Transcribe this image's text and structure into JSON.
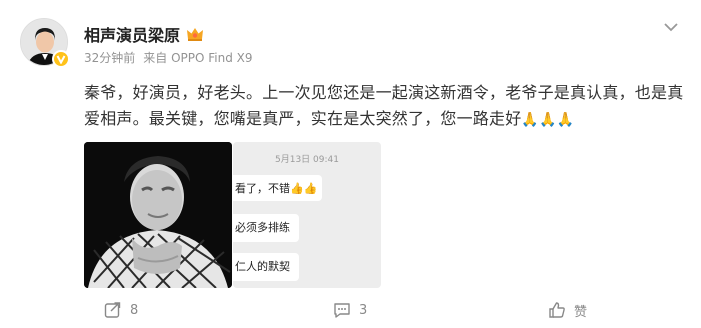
{
  "post": {
    "author": {
      "name": "相声演员梁原",
      "avatar": "avatar-photo",
      "verified_badge": "verified-v-icon",
      "member_badge": "crown-icon"
    },
    "meta": {
      "time": "32分钟前",
      "source": "来自 OPPO Find X9"
    },
    "text": "秦爷，好演员，好老头。上一次见您还是一起演这新酒令，老爷子是真认真，也是真爱相声。最关键，您嘴是真严，实在是太突然了，您一路走好",
    "emoji": "🙏🙏🙏",
    "images": [
      {
        "kind": "photo-portrait-bw",
        "description": ""
      },
      {
        "kind": "chat-screenshot"
      }
    ],
    "chat": {
      "time": "5月13日 09:41",
      "bubbles": [
        "看了，不错👍👍",
        "必须多排练",
        "仁人的默契"
      ]
    },
    "actions": {
      "repost": {
        "icon": "repost-icon",
        "count": "8"
      },
      "comment": {
        "icon": "comment-icon",
        "count": "3"
      },
      "like": {
        "icon": "thumbs-up-icon",
        "label": "赞"
      }
    }
  },
  "colors": {
    "text": "#333333",
    "muted": "#939393",
    "badge": "#ffc21a",
    "crown": "#f6a623"
  }
}
